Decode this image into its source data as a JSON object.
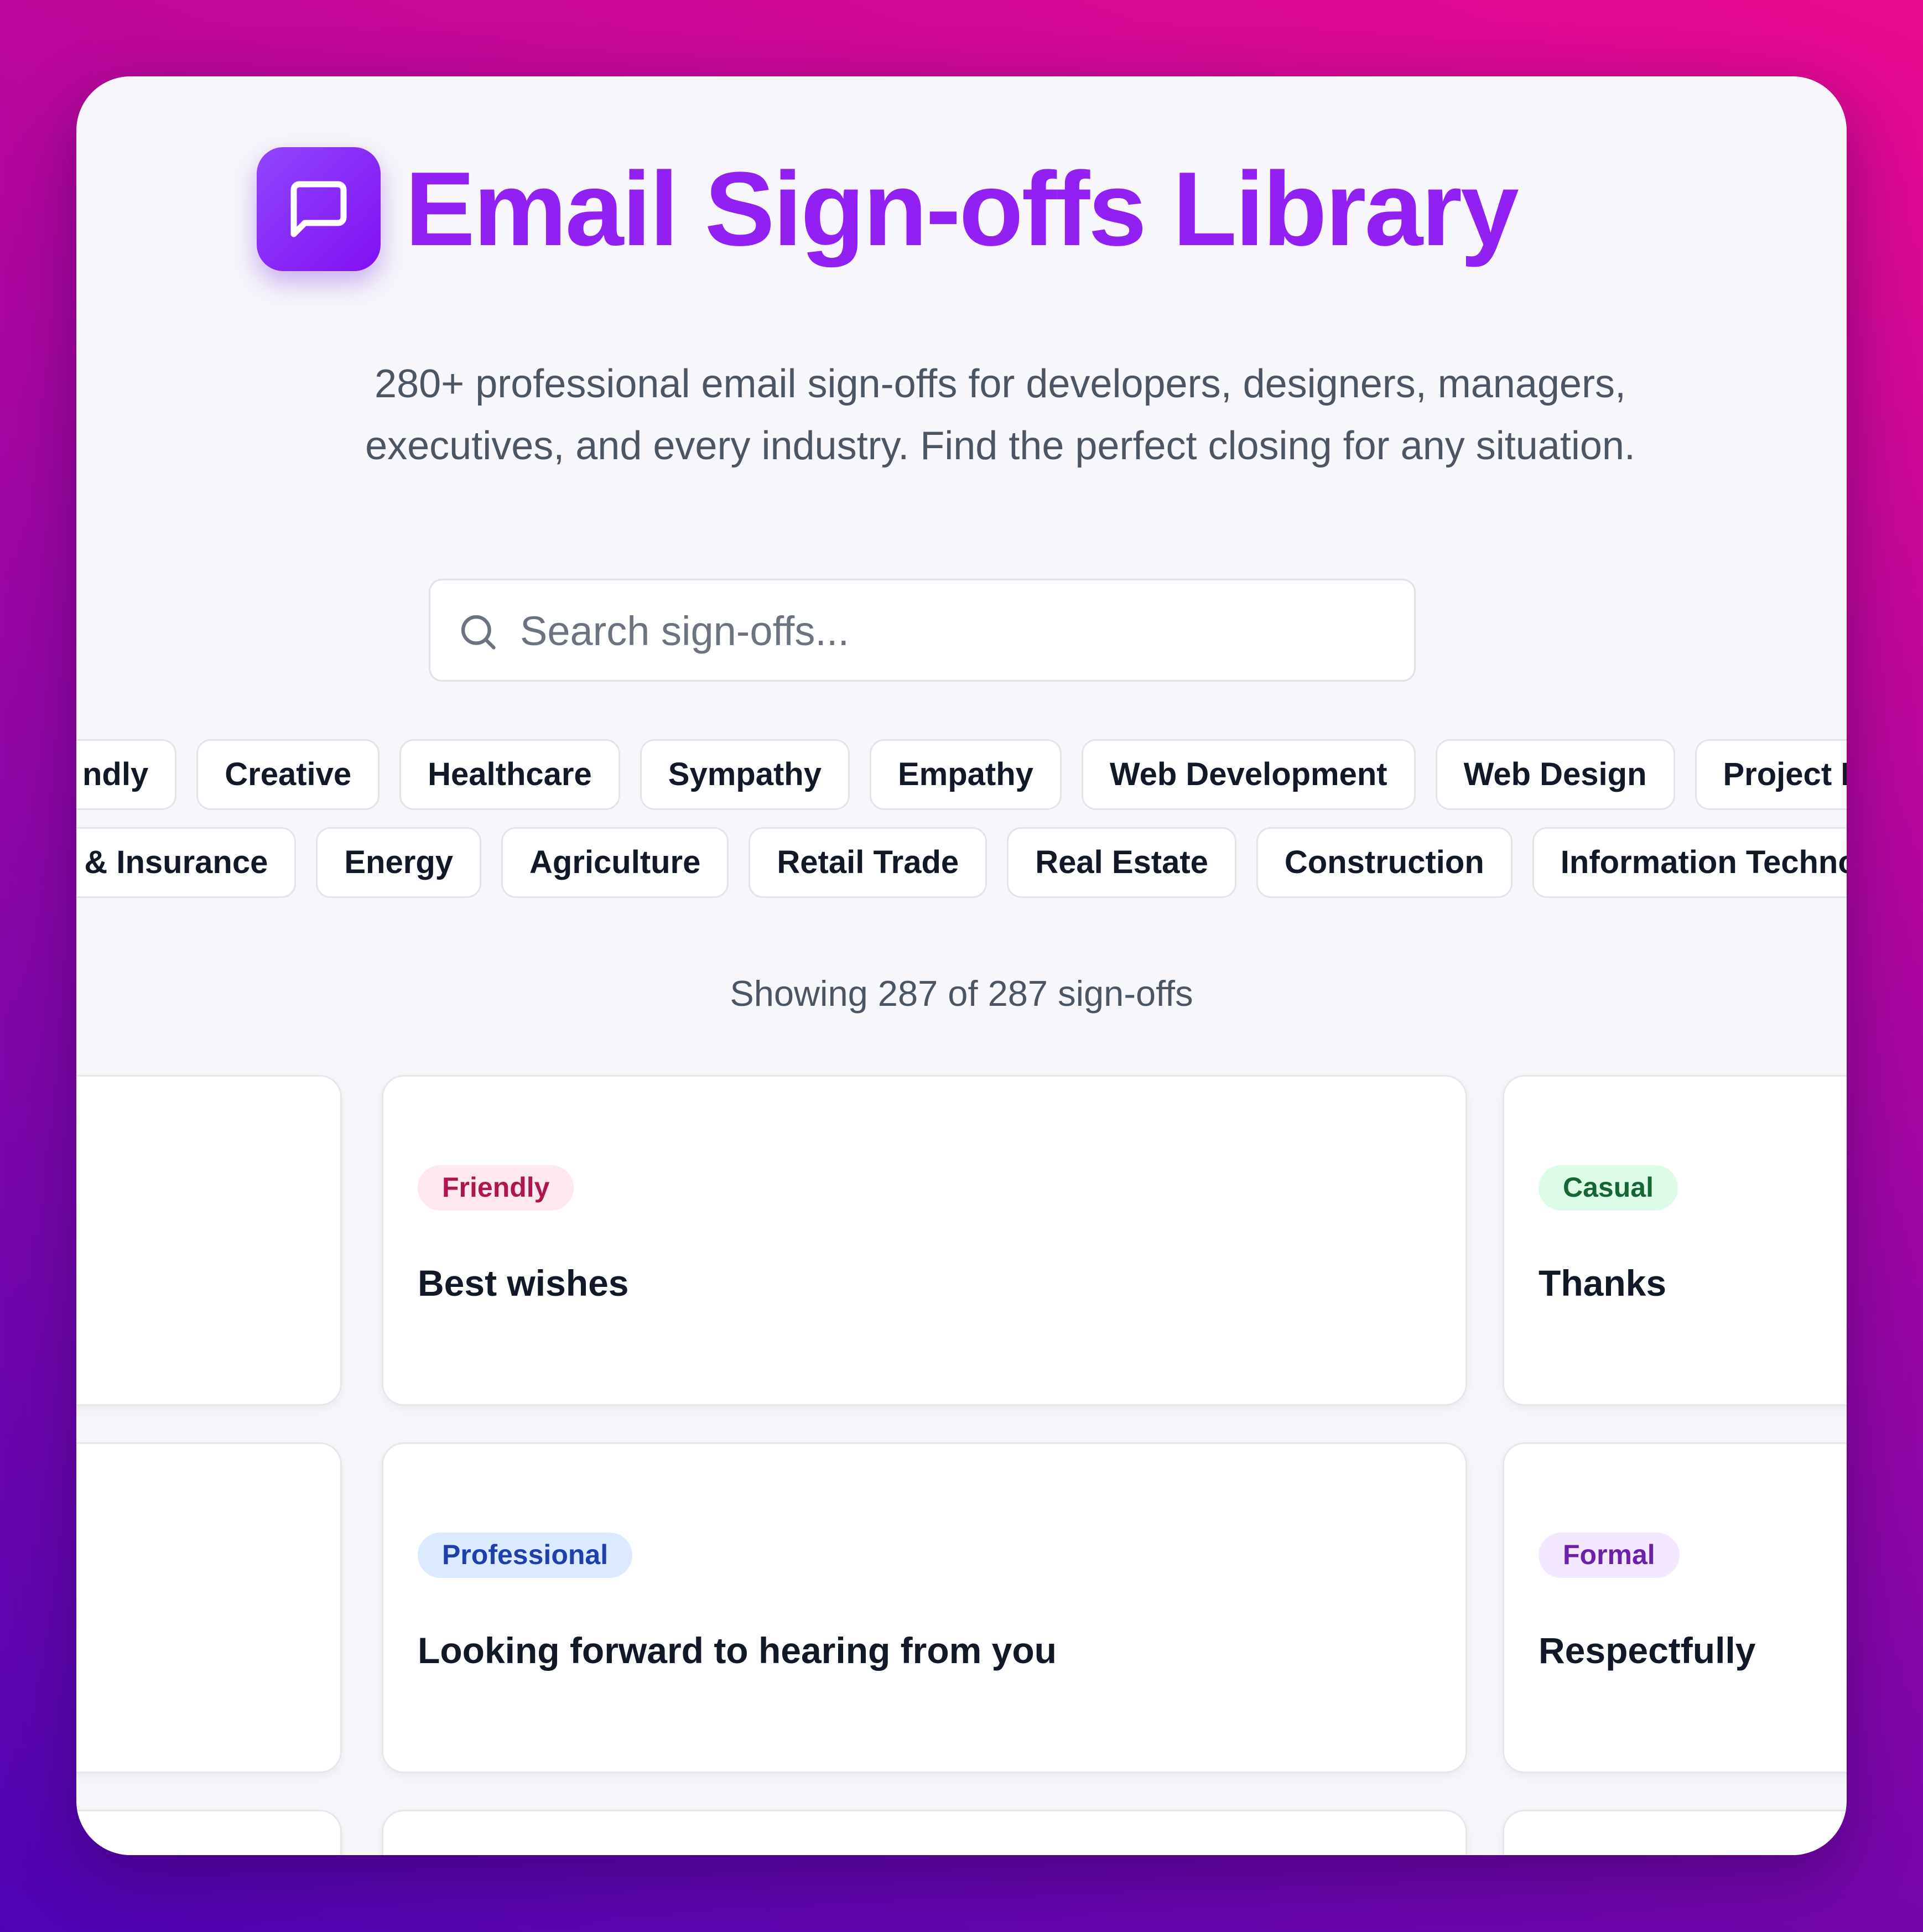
{
  "header": {
    "title": "Email Sign-offs Library",
    "subtitle_line1": "280+ professional email sign-offs for developers, designers, managers,",
    "subtitle_line2": "executives, and every industry. Find the perfect closing for any situation.",
    "logo_icon": "message-square-icon"
  },
  "search": {
    "placeholder": "Search sign-offs...",
    "value": "",
    "icon": "search-icon"
  },
  "filters": {
    "row1": [
      "ndly",
      "Creative",
      "Healthcare",
      "Sympathy",
      "Empathy",
      "Web Development",
      "Web Design",
      "Project Man"
    ],
    "row2": [
      "e & Insurance",
      "Energy",
      "Agriculture",
      "Retail Trade",
      "Real Estate",
      "Construction",
      "Information Technolog"
    ]
  },
  "results": {
    "count_text": "Showing 287 of 287 sign-offs"
  },
  "cards": [
    {
      "tone": "Friendly",
      "text": "Best wishes"
    },
    {
      "tone": "Casual",
      "text": "Thanks"
    },
    {
      "tone": "Professional",
      "text": "Looking forward to hearing from you"
    },
    {
      "tone": "Formal",
      "text": "Respectfully"
    }
  ],
  "colors": {
    "brand": "#9220f2",
    "friendly": "#b0154f",
    "casual": "#166534",
    "professional": "#1e40af",
    "formal": "#6b21a8"
  }
}
